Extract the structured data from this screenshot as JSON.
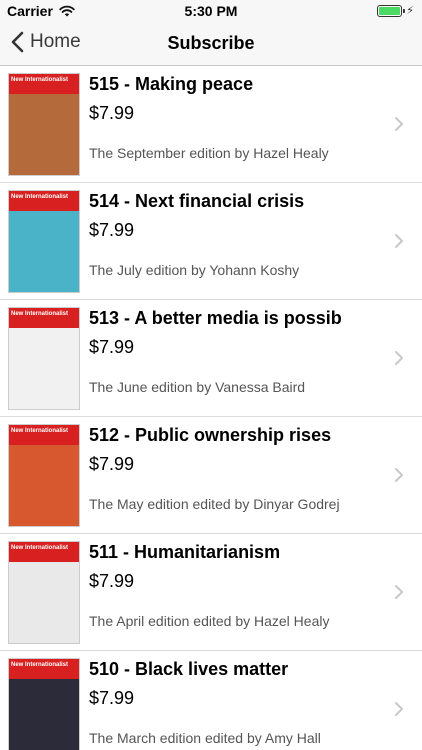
{
  "status_bar": {
    "carrier": "Carrier",
    "time": "5:30 PM",
    "battery_level": 1.0
  },
  "nav": {
    "back_label": "Home",
    "title": "Subscribe"
  },
  "editions": [
    {
      "title": "515 - Making peace",
      "price": "$7.99",
      "subtitle": "The September edition by Hazel Healy",
      "cover_color": "#b56a3c",
      "cover_masthead": "New Internationalist"
    },
    {
      "title": "514 - Next financial crisis",
      "price": "$7.99",
      "subtitle": "The July edition by Yohann Koshy",
      "cover_color": "#4ab3c8",
      "cover_masthead": "New Internationalist"
    },
    {
      "title": "513 - A better media is possib",
      "price": "$7.99",
      "subtitle": "The June edition by Vanessa Baird",
      "cover_color": "#f1f1f1",
      "cover_masthead": "New Internationalist"
    },
    {
      "title": "512 - Public ownership rises",
      "price": "$7.99",
      "subtitle": "The May edition edited by Dinyar Godrej",
      "cover_color": "#d7572e",
      "cover_masthead": "New Internationalist"
    },
    {
      "title": "511 - Humanitarianism",
      "price": "$7.99",
      "subtitle": "The April edition edited by Hazel Healy",
      "cover_color": "#e9e9e9",
      "cover_masthead": "New Internationalist"
    },
    {
      "title": "510 - Black lives matter",
      "price": "$7.99",
      "subtitle": "The March edition edited by Amy Hall",
      "cover_color": "#2b2b3a",
      "cover_masthead": "New Internationalist"
    }
  ]
}
